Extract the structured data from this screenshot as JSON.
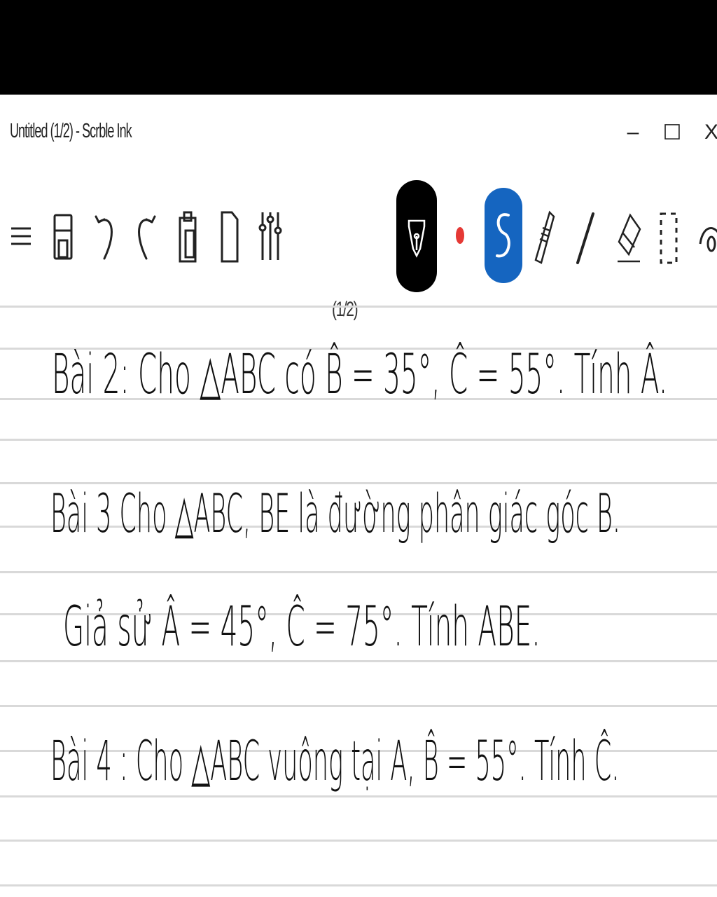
{
  "window": {
    "title": "Untitled (1/2) - Scrble Ink",
    "minimize_glyph": "–",
    "maximize_glyph": "☐",
    "close_glyph": "X"
  },
  "toolbar": {
    "page_indicator": "(1/2)",
    "pen_color": "#e53935",
    "accent_pen_bg": "#1565c0",
    "icons": [
      "menu-icon",
      "save-icon",
      "undo-icon",
      "redo-icon",
      "paste-icon",
      "new-page-icon",
      "settings-sliders-icon",
      "fountain-pen-icon",
      "color-dot-icon",
      "scrble-icon",
      "highlighter-icon",
      "line-icon",
      "eraser-icon",
      "selection-icon",
      "view-icon"
    ]
  },
  "notes": {
    "line1": "Bài 2: Cho △ABC có B̂ = 35°, Ĉ = 55°. Tính Â.",
    "line2": "Bài 3 Cho △ABC, BE là đường phân giác góc B.",
    "line3": "Giả sử Â = 45°, Ĉ = 75°. Tính ABE.",
    "line4": "Bài 4 : Cho △ABC vuông tại A, B̂ = 55°. Tính Ĉ."
  }
}
